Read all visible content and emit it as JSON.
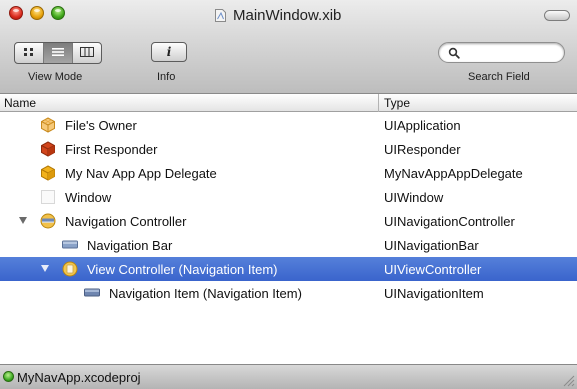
{
  "window": {
    "title": "MainWindow.xib"
  },
  "toolbar": {
    "view_mode_label": "View Mode",
    "info_label": "Info",
    "info_glyph": "i",
    "search_label": "Search Field",
    "search_placeholder": "",
    "view_modes": [
      {
        "name": "icon-view",
        "icon": "grid-icon",
        "selected": false
      },
      {
        "name": "list-view",
        "icon": "list-icon",
        "selected": true
      },
      {
        "name": "column-view",
        "icon": "columns-icon",
        "selected": false
      }
    ]
  },
  "table": {
    "columns": [
      "Name",
      "Type"
    ],
    "rows": [
      {
        "name": "File's Owner",
        "type": "UIApplication",
        "icon": "cube-outline-icon",
        "level": 0,
        "expanded": null,
        "selected": false
      },
      {
        "name": "First Responder",
        "type": "UIResponder",
        "icon": "red-cube-icon",
        "level": 0,
        "expanded": null,
        "selected": false
      },
      {
        "name": "My Nav App App Delegate",
        "type": "MyNavAppAppDelegate",
        "icon": "yellow-cube-icon",
        "level": 0,
        "expanded": null,
        "selected": false
      },
      {
        "name": "Window",
        "type": "UIWindow",
        "icon": "window-icon",
        "level": 0,
        "expanded": null,
        "selected": false
      },
      {
        "name": "Navigation Controller",
        "type": "UINavigationController",
        "icon": "navigation-controller-icon",
        "level": 0,
        "expanded": true,
        "selected": false
      },
      {
        "name": "Navigation Bar",
        "type": "UINavigationBar",
        "icon": "navigation-bar-icon",
        "level": 1,
        "expanded": null,
        "selected": false
      },
      {
        "name": "View Controller (Navigation Item)",
        "type": "UIViewController",
        "icon": "view-controller-icon",
        "level": 1,
        "expanded": true,
        "selected": true
      },
      {
        "name": "Navigation Item (Navigation Item)",
        "type": "UINavigationItem",
        "icon": "navigation-item-icon",
        "level": 2,
        "expanded": null,
        "selected": false
      }
    ]
  },
  "status": {
    "project": "MyNavApp.xcodeproj"
  },
  "colors": {
    "selection": "#3d67cf",
    "status_dot": "#35a51c"
  }
}
